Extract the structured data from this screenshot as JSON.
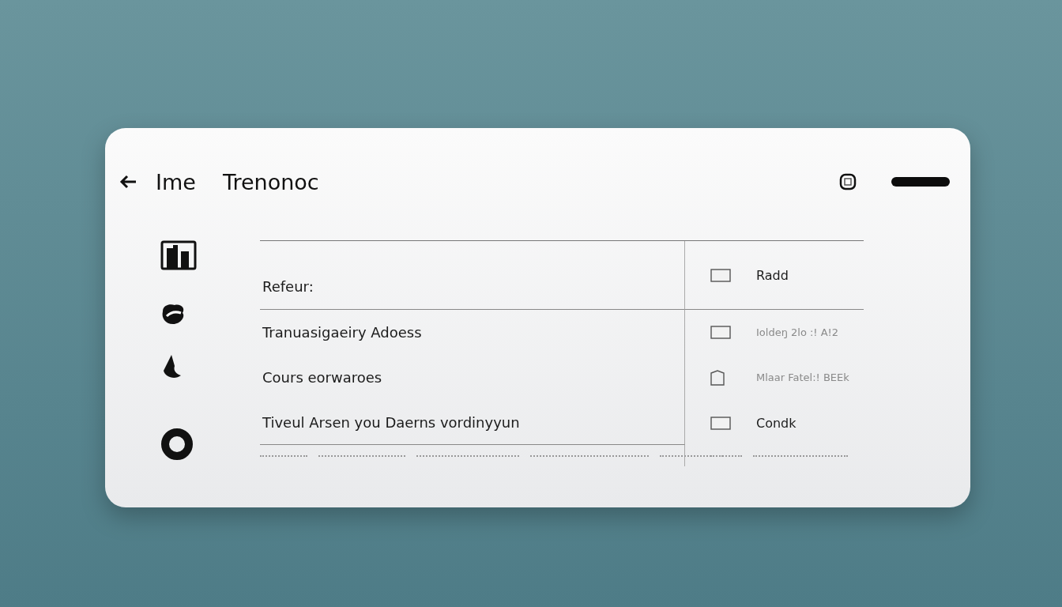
{
  "header": {
    "title": "Ime",
    "subtitle": "Trenonoc"
  },
  "list": {
    "rows": [
      {
        "label": "Refeur:"
      },
      {
        "label": "Tranuasigaeiry Adoess"
      },
      {
        "label": "Cours eorwaroes"
      },
      {
        "label": "Tiveul Arsen you Daerns vordinyyun"
      }
    ]
  },
  "side_list": {
    "rows": [
      {
        "label": "Radd",
        "muted": false
      },
      {
        "label": "Ioldeŋ 2lo :! A!2",
        "muted": true
      },
      {
        "label": "Mlaar Fatel:! BEEk",
        "muted": true
      },
      {
        "label": "Condk",
        "muted": false
      }
    ]
  }
}
